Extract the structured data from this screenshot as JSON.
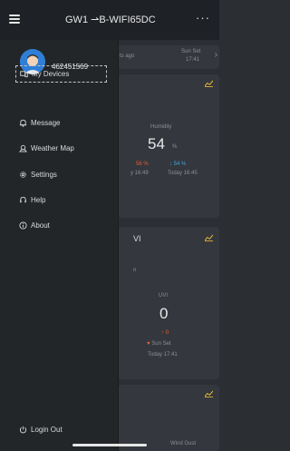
{
  "topbar": {
    "title": "GW1  ⇀B-WIFI65DC",
    "more": "···"
  },
  "user": {
    "name": "462451569"
  },
  "menu": {
    "items": [
      {
        "label": "My Devices",
        "icon": "devices-icon"
      },
      {
        "label": "Message",
        "icon": "bell-icon"
      },
      {
        "label": "Weather Map",
        "icon": "map-icon"
      },
      {
        "label": "Settings",
        "icon": "gear-icon"
      },
      {
        "label": "Help",
        "icon": "headset-icon"
      },
      {
        "label": "About",
        "icon": "info-icon"
      }
    ],
    "logout": "Login Out"
  },
  "background": {
    "card1": {
      "time_ago": "ts ago",
      "sunset_label": "Sun Set",
      "sunset_time": "17:41"
    },
    "card2": {
      "label": "Humidity",
      "value": "54",
      "unit": "%",
      "max": "56 %",
      "min": "↓ 54 %",
      "max_time": "y 16:49",
      "min_time": "Today 16:45"
    },
    "card3": {
      "title": "VI",
      "sub": "n",
      "label": "UVI",
      "value": "0",
      "max": "↑ 0",
      "sunset": "Sun Set",
      "sunset_time": "Today 17:41"
    },
    "card4": {
      "wind_gust": "Wind Gust"
    }
  },
  "colors": {
    "accent": "#e0b13a",
    "warm": "#e0623b",
    "cool": "#3fa7d8"
  }
}
